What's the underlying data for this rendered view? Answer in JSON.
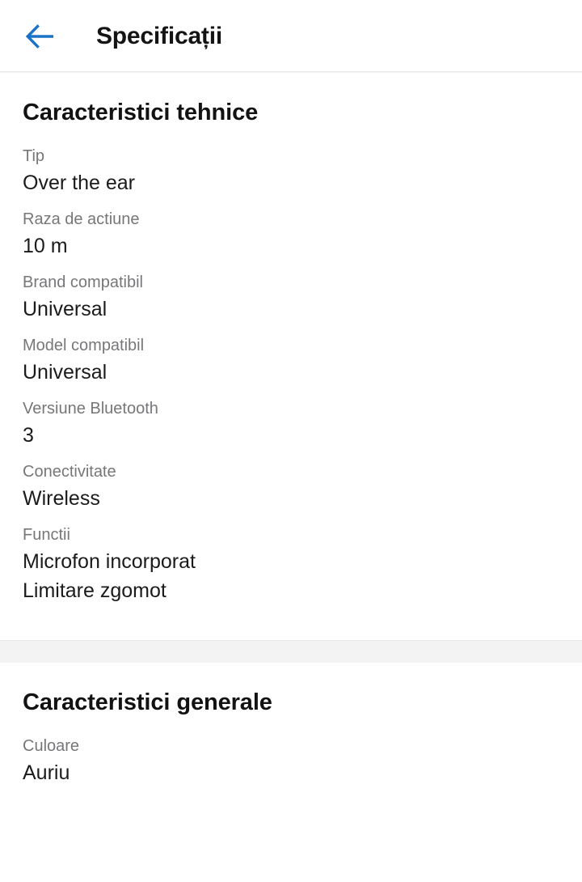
{
  "header": {
    "back_icon": "arrow-left-icon",
    "title": "Specificații",
    "accent_color": "#1a73c8"
  },
  "colors": {
    "background": "#ffffff",
    "divider_band": "#f3f3f4",
    "label_text": "#77777a",
    "value_text": "#1b1b1b",
    "heading_text": "#121212"
  },
  "sections": [
    {
      "title": "Caracteristici tehnice",
      "rows": [
        {
          "label": "Tip",
          "values": [
            "Over the ear"
          ]
        },
        {
          "label": "Raza de actiune",
          "values": [
            "10 m"
          ]
        },
        {
          "label": "Brand compatibil",
          "values": [
            "Universal"
          ]
        },
        {
          "label": "Model compatibil",
          "values": [
            "Universal"
          ]
        },
        {
          "label": "Versiune Bluetooth",
          "values": [
            "3"
          ]
        },
        {
          "label": "Conectivitate",
          "values": [
            "Wireless"
          ]
        },
        {
          "label": "Functii",
          "values": [
            "Microfon incorporat",
            "Limitare zgomot"
          ]
        }
      ]
    },
    {
      "title": "Caracteristici generale",
      "rows": [
        {
          "label": "Culoare",
          "values": [
            "Auriu"
          ]
        }
      ]
    }
  ]
}
